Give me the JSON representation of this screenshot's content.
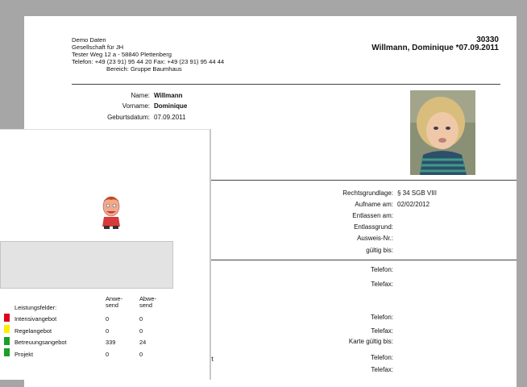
{
  "header": {
    "org": "Demo Daten",
    "org2": "Gesellschaft für JH",
    "address": "Tester Weg 12 a - 58840 Plettenberg",
    "phone_fax": "Telefon: +49 (23 91) 95 44 20  Fax: +49 (23 91) 95 44 44",
    "area_label": "Bereich:",
    "area_value": "Gruppe Baumhaus",
    "number": "30330",
    "name": "Willmann, Dominique *07.09.2011"
  },
  "person": {
    "name_label": "Name:",
    "name_value": "Willmann",
    "vorname_label": "Vorname:",
    "vorname_value": "Dominique",
    "geb_label": "Geburtsdatum:",
    "geb_value": "07.09.2011"
  },
  "admin": {
    "rechts_label": "Rechtsgrundlage:",
    "rechts_value": "§ 34 SGB VIII",
    "aufname_label": "Aufname am:",
    "aufname_value": "02/02/2012",
    "entlassen_label": "Entlassen am:",
    "grund_label": "Entlassgrund:",
    "ausweis_label": "Ausweis-Nr.:",
    "gueltig_label": "gültig bis:"
  },
  "contact": {
    "tel1": "Telefon:",
    "fax1": "Telefax:",
    "tel2": "Telefon:",
    "fax2": "Telefax:",
    "karte": "Karte gültig bis:",
    "tel3": "Telefon:",
    "fax3": "Telefax:",
    "partial": "rt"
  },
  "services": {
    "header_field": "Leistungsfelder:",
    "header_anw": "Anwe-\nsend",
    "header_abw": "Abwe-\nsend",
    "rows": [
      {
        "label": "Intensivangebot",
        "anw": "0",
        "abw": "0",
        "color": "#e0001b"
      },
      {
        "label": "Regelangebot",
        "anw": "0",
        "abw": "0",
        "color": "#ffee00"
      },
      {
        "label": "Betreuungsangebot",
        "anw": "339",
        "abw": "24",
        "color": "#18a028"
      },
      {
        "label": "Projekt",
        "anw": "0",
        "abw": "0",
        "color": "#18a028"
      }
    ]
  }
}
